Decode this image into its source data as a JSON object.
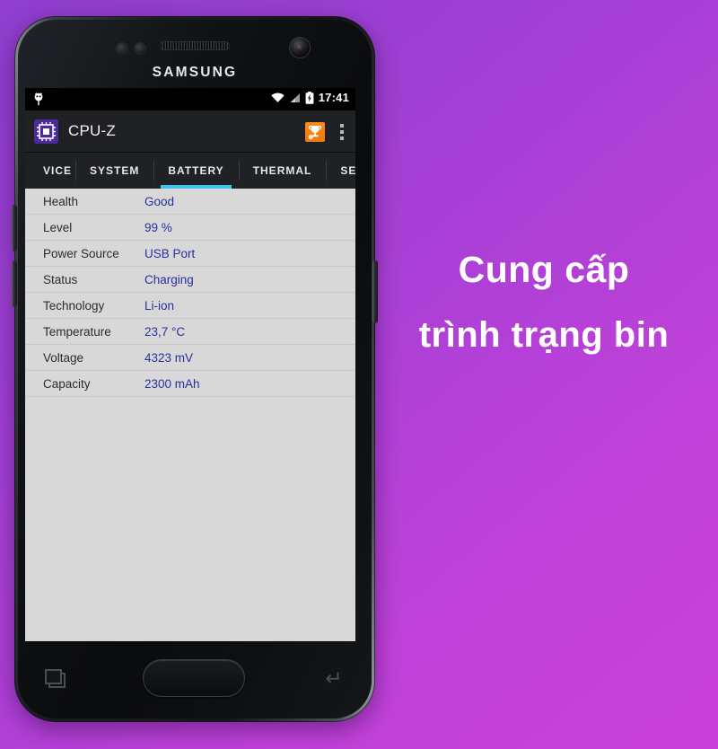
{
  "device": {
    "brand": "SAMSUNG",
    "hardware": {
      "earpiece": "earpiece-speaker",
      "front_camera": "front-camera",
      "proximity_sensor": "proximity-sensor",
      "home_button": "home-button",
      "capacitive_recents": "recents-key",
      "capacitive_back": "back-key",
      "volume_up": "volume-up-button",
      "volume_down": "volume-down-button",
      "power": "power-button"
    }
  },
  "status_bar": {
    "time": "17:41",
    "icons": [
      "android-notification-icon",
      "wifi-icon",
      "signal-icon",
      "battery-charging-icon"
    ]
  },
  "action_bar": {
    "app_icon": "cpu-chip-icon",
    "title": "CPU-Z",
    "benchmark_icon": "trophy-icon",
    "overflow_icon": "overflow-menu-icon"
  },
  "tabs": [
    {
      "label": "VICE",
      "active": false
    },
    {
      "label": "SYSTEM",
      "active": false
    },
    {
      "label": "BATTERY",
      "active": true
    },
    {
      "label": "THERMAL",
      "active": false
    },
    {
      "label": "SENS",
      "active": false
    }
  ],
  "battery": {
    "rows": [
      {
        "label": "Health",
        "value": "Good"
      },
      {
        "label": "Level",
        "value": "99 %"
      },
      {
        "label": "Power Source",
        "value": "USB Port"
      },
      {
        "label": "Status",
        "value": "Charging"
      },
      {
        "label": "Technology",
        "value": "Li-ion"
      },
      {
        "label": "Temperature",
        "value": "23,7 °C"
      },
      {
        "label": "Voltage",
        "value": "4323 mV"
      },
      {
        "label": "Capacity",
        "value": "2300 mAh"
      }
    ]
  },
  "nav_bar": {
    "back": "back-icon",
    "home": "home-icon",
    "recents": "recents-icon"
  },
  "marketing": {
    "line1": "Cung cấp",
    "line2": "trình trạng bin"
  },
  "colors": {
    "accent_tab": "#40c4ef",
    "value_text": "#2a2f9e",
    "app_icon_bg": "#4b2a9e",
    "benchmark_bg": "#f0770c",
    "screen_bg": "#d8d8d8",
    "bg_gradient_start": "#8f3ece",
    "bg_gradient_end": "#c941d8"
  }
}
